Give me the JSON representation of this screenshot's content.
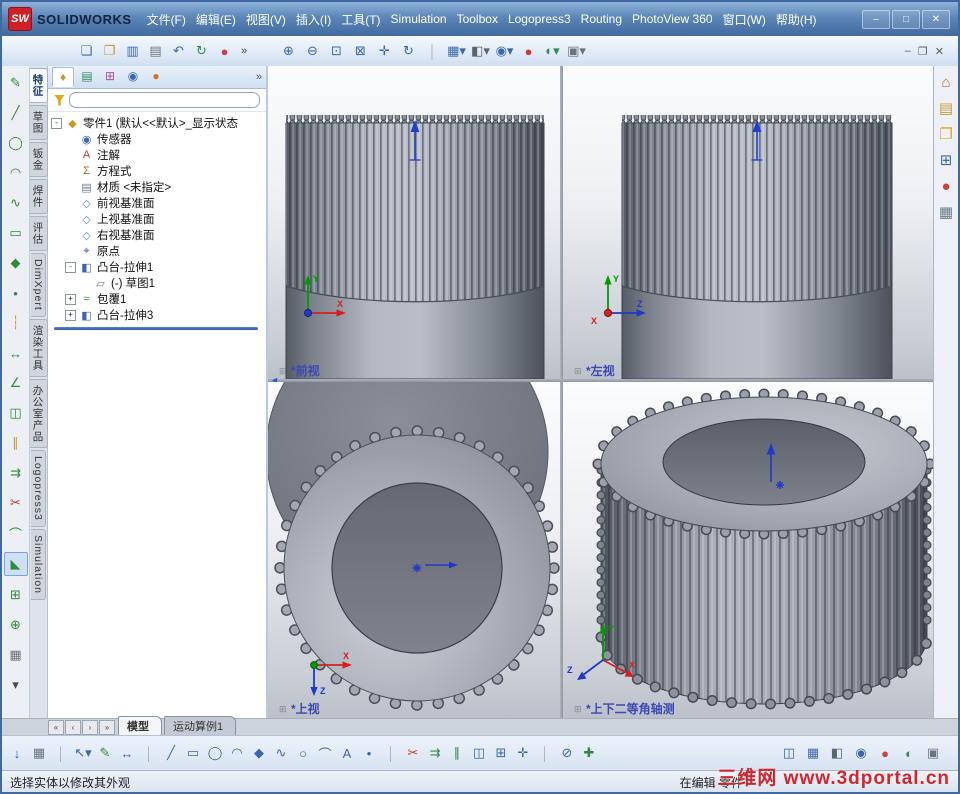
{
  "titlebar": {
    "logo_mark": "SW",
    "logo_text": "SOLIDWORKS",
    "menus": [
      "文件(F)",
      "编辑(E)",
      "视图(V)",
      "插入(I)",
      "工具(T)",
      "Simulation",
      "Toolbox",
      "Logopress3",
      "Routing",
      "PhotoView 360",
      "窗口(W)",
      "帮助(H)"
    ],
    "window_controls": [
      {
        "name": "minimize-button",
        "g": "–"
      },
      {
        "name": "maximize-button",
        "g": "□"
      },
      {
        "name": "close-button",
        "g": "✕"
      }
    ]
  },
  "toolbar": {
    "left_icons": [
      {
        "name": "new-document-icon",
        "g": "❏",
        "c": "#3a68b0"
      },
      {
        "name": "open-document-icon",
        "g": "❐",
        "c": "#c79a2e"
      },
      {
        "name": "save-icon",
        "g": "▥",
        "c": "#3a68b0"
      },
      {
        "name": "print-icon",
        "g": "▤",
        "c": "#6a7480"
      },
      {
        "name": "undo-icon",
        "g": "↶",
        "c": "#3a68b0"
      },
      {
        "name": "rebuild-icon",
        "g": "↻",
        "c": "#2e8b57"
      },
      {
        "name": "edit-appearance-icon",
        "g": "●",
        "c": "#cc4040"
      }
    ],
    "overflow": "»",
    "view_icons": [
      {
        "name": "zoom-in-icon",
        "g": "⊕",
        "c": "#3a68b0"
      },
      {
        "name": "zoom-out-icon",
        "g": "⊖",
        "c": "#3a68b0"
      },
      {
        "name": "zoom-area-icon",
        "g": "⊡",
        "c": "#3a68b0"
      },
      {
        "name": "zoom-fit-icon",
        "g": "⊠",
        "c": "#3a68b0"
      },
      {
        "name": "pan-icon",
        "g": "✛",
        "c": "#3a68b0"
      },
      {
        "name": "rotate-view-icon",
        "g": "↻",
        "c": "#3a68b0"
      },
      {
        "name": "separator-icon",
        "g": "│",
        "c": "#a8b2c0"
      },
      {
        "name": "view-orientation-icon",
        "g": "▦▾",
        "c": "#3a68b0"
      },
      {
        "name": "display-style-icon",
        "g": "◧▾",
        "c": "#5a6470"
      },
      {
        "name": "hide-show-items-icon",
        "g": "◉▾",
        "c": "#3a68b0"
      },
      {
        "name": "appearance-ball-icon",
        "g": "●",
        "c": "#d0392e"
      },
      {
        "name": "scene-icon",
        "g": "◐▾",
        "c": "#2e8b57"
      },
      {
        "name": "camera-icon",
        "g": "▣▾",
        "c": "#6a7480"
      }
    ],
    "doc_controls": [
      {
        "name": "doc-minimize-button",
        "g": "–"
      },
      {
        "name": "doc-restore-button",
        "g": "❐"
      },
      {
        "name": "doc-close-button",
        "g": "✕"
      }
    ]
  },
  "left_toolbar": {
    "icons": [
      {
        "name": "sketch-icon",
        "g": "✎",
        "c": "#2e8b3a"
      },
      {
        "name": "line-icon",
        "g": "╱",
        "c": "#2e8b3a"
      },
      {
        "name": "circle-icon",
        "g": "◯",
        "c": "#2e8b3a"
      },
      {
        "name": "arc-icon",
        "g": "◠",
        "c": "#2e8b3a"
      },
      {
        "name": "spline-icon",
        "g": "∿",
        "c": "#2e8b3a"
      },
      {
        "name": "rectangle-icon",
        "g": "▭",
        "c": "#2e8b3a"
      },
      {
        "name": "polygon-icon",
        "g": "◆",
        "c": "#2e8b3a"
      },
      {
        "name": "point-icon",
        "g": "•",
        "c": "#2e8b3a"
      },
      {
        "name": "centerline-icon",
        "g": "┆",
        "c": "#c79a2e"
      },
      {
        "name": "dimension-icon",
        "g": "↔",
        "c": "#2e8b3a"
      },
      {
        "name": "relation-icon",
        "g": "∠",
        "c": "#2e8b3a"
      },
      {
        "name": "mirror-icon",
        "g": "◫",
        "c": "#2e8b3a"
      },
      {
        "name": "offset-icon",
        "g": "∥",
        "c": "#c79a2e"
      },
      {
        "name": "convert-entities-icon",
        "g": "⇉",
        "c": "#2e8b3a"
      },
      {
        "name": "trim-icon",
        "g": "✂",
        "c": "#c0392b"
      },
      {
        "name": "fillet-icon",
        "g": "⌒",
        "c": "#2e8b3a"
      },
      {
        "name": "chamfer-icon",
        "g": "◣",
        "c": "#2e8b3a",
        "cls": "pressed"
      },
      {
        "name": "linear-pattern-icon",
        "g": "⊞",
        "c": "#2e8b3a"
      },
      {
        "name": "circular-pattern-icon",
        "g": "⊕",
        "c": "#2e8b3a"
      },
      {
        "name": "sketch-picture-icon",
        "g": "▦",
        "c": "#6a7480"
      },
      {
        "name": "more-tools-icon",
        "g": "▾",
        "c": "#444c58"
      }
    ]
  },
  "side_tabs": {
    "items": [
      {
        "label": "特征",
        "cls": "active"
      },
      {
        "label": "草图",
        "cls": ""
      },
      {
        "label": "钣金",
        "cls": ""
      },
      {
        "label": "焊件",
        "cls": ""
      },
      {
        "label": "评估",
        "cls": ""
      },
      {
        "label": "DimXpert",
        "cls": ""
      },
      {
        "label": "渲染工具",
        "cls": ""
      },
      {
        "label": "办公室产品",
        "cls": ""
      },
      {
        "label": "Logopress3",
        "cls": ""
      },
      {
        "label": "Simulation",
        "cls": ""
      }
    ]
  },
  "feature_panel": {
    "manager_tabs": [
      {
        "name": "featuremanager-tree-icon",
        "g": "♦",
        "c": "#c79a2e",
        "cls": "active"
      },
      {
        "name": "propertymanager-icon",
        "g": "▤",
        "c": "#2e8b57"
      },
      {
        "name": "configurationmanager-icon",
        "g": "⊞",
        "c": "#b05090"
      },
      {
        "name": "dimxpertmanager-icon",
        "g": "◉",
        "c": "#3a68b0"
      },
      {
        "name": "displaymanager-icon",
        "g": "●",
        "c": "#d07030"
      }
    ],
    "overflow": "»",
    "tree": [
      {
        "expander": "-",
        "icon": "◆",
        "c": "#c79a2e",
        "label": "零件1 (默认<<默认>_显示状态",
        "cls": "ind0"
      },
      {
        "expander": "",
        "icon": "◉",
        "c": "#3a68b0",
        "label": "传感器",
        "cls": "ind1"
      },
      {
        "expander": "",
        "icon": "A",
        "c": "#b84040",
        "label": "注解",
        "cls": "ind1"
      },
      {
        "expander": "",
        "icon": "Σ",
        "c": "#b06820",
        "label": "方程式",
        "cls": "ind1"
      },
      {
        "expander": "",
        "icon": "▤",
        "c": "#6a7a8a",
        "label": "材质 <未指定>",
        "cls": "ind1"
      },
      {
        "expander": "",
        "icon": "◇",
        "c": "#4a90c0",
        "label": "前视基准面",
        "cls": "ind1"
      },
      {
        "expander": "",
        "icon": "◇",
        "c": "#4a90c0",
        "label": "上视基准面",
        "cls": "ind1"
      },
      {
        "expander": "",
        "icon": "◇",
        "c": "#4a90c0",
        "label": "右视基准面",
        "cls": "ind1"
      },
      {
        "expander": "",
        "icon": "⌖",
        "c": "#2a50b0",
        "label": "原点",
        "cls": "ind1"
      },
      {
        "expander": "-",
        "icon": "◧",
        "c": "#3a68b0",
        "label": "凸台-拉伸1",
        "cls": "ind1"
      },
      {
        "expander": "",
        "icon": "▱",
        "c": "#6a7480",
        "label": "(-) 草图1",
        "cls": "ind2"
      },
      {
        "expander": "+",
        "icon": "≈",
        "c": "#2e8b32",
        "label": "包覆1",
        "cls": "ind1"
      },
      {
        "expander": "+",
        "icon": "◧",
        "c": "#3a68b0",
        "label": "凸台-拉伸3",
        "cls": "ind1"
      }
    ]
  },
  "viewports": {
    "front": {
      "label": "*前视"
    },
    "left": {
      "label": "*左视"
    },
    "top": {
      "label": "*上视"
    },
    "iso": {
      "label": "*上下二等角轴测"
    },
    "axis_labels": {
      "x": "X",
      "y": "Y",
      "z": "Z"
    },
    "accent_blue": "#2038c8",
    "part_gray": "#a6abb5"
  },
  "task_pane": {
    "icons": [
      {
        "name": "home-icon",
        "g": "⌂",
        "c": "#b07830"
      },
      {
        "name": "design-library-icon",
        "g": "▤",
        "c": "#c79a2e"
      },
      {
        "name": "file-explorer-icon",
        "g": "❐",
        "c": "#d8a818"
      },
      {
        "name": "view-palette-icon",
        "g": "⊞",
        "c": "#3a68b0"
      },
      {
        "name": "appearances-icon",
        "g": "●",
        "c": "#cc4040"
      },
      {
        "name": "custom-properties-icon",
        "g": "▦",
        "c": "#6a7a8a"
      }
    ]
  },
  "bottom_tabs": {
    "nav": [
      {
        "name": "first-tab-button",
        "g": "«"
      },
      {
        "name": "prev-tab-button",
        "g": "‹"
      },
      {
        "name": "next-tab-button",
        "g": "›"
      },
      {
        "name": "last-tab-button",
        "g": "»"
      }
    ],
    "tabs": [
      {
        "label": "模型",
        "cls": "active"
      },
      {
        "label": "运动算例1",
        "cls": ""
      }
    ]
  },
  "bottom_toolbar": {
    "left_icons": [
      {
        "name": "snap-icon",
        "g": "↓",
        "c": "#2458c8"
      },
      {
        "name": "grid-icon",
        "g": "▦",
        "c": "#6a7480"
      },
      {
        "name": "separator-icon",
        "g": "│",
        "c": "#a8b2c0"
      },
      {
        "name": "select-icon",
        "g": "↖▾",
        "c": "#3a68b0"
      },
      {
        "name": "sketch-icon",
        "g": "✎",
        "c": "#2e8b3a"
      },
      {
        "name": "smart-dimension-icon",
        "g": "↔",
        "c": "#3a68b0"
      },
      {
        "name": "separator-icon",
        "g": "│",
        "c": "#a8b2c0"
      },
      {
        "name": "line-icon",
        "g": "╱",
        "c": "#3a68b0"
      },
      {
        "name": "rectangle-icon",
        "g": "▭",
        "c": "#3a68b0"
      },
      {
        "name": "circle-icon",
        "g": "◯",
        "c": "#3a68b0"
      },
      {
        "name": "arc-icon",
        "g": "◠",
        "c": "#3a68b0"
      },
      {
        "name": "polygon-icon",
        "g": "◆",
        "c": "#3a68b0"
      },
      {
        "name": "spline-icon",
        "g": "∿",
        "c": "#3a68b0"
      },
      {
        "name": "ellipse-icon",
        "g": "○",
        "c": "#3a68b0"
      },
      {
        "name": "fillet-icon",
        "g": "⌒",
        "c": "#3a68b0"
      },
      {
        "name": "text-icon",
        "g": "A",
        "c": "#3a68b0"
      },
      {
        "name": "point-icon",
        "g": "•",
        "c": "#3a68b0"
      },
      {
        "name": "separator-icon",
        "g": "│",
        "c": "#a8b2c0"
      },
      {
        "name": "trim-icon",
        "g": "✂",
        "c": "#c0392b"
      },
      {
        "name": "convert-entities-icon",
        "g": "⇉",
        "c": "#2e8b3a"
      },
      {
        "name": "offset-icon",
        "g": "∥",
        "c": "#2e8b3a"
      },
      {
        "name": "mirror-icon",
        "g": "◫",
        "c": "#3a68b0"
      },
      {
        "name": "linear-pattern-icon",
        "g": "⊞",
        "c": "#3a68b0"
      },
      {
        "name": "move-icon",
        "g": "✛",
        "c": "#3a68b0"
      },
      {
        "name": "separator-icon",
        "g": "│",
        "c": "#a8b2c0"
      },
      {
        "name": "display-delete-relations-icon",
        "g": "⊘",
        "c": "#3a68b0"
      },
      {
        "name": "repair-sketch-icon",
        "g": "✚",
        "c": "#2e8b3a"
      }
    ],
    "right_icons": [
      {
        "name": "section-view-icon",
        "g": "◫",
        "c": "#3a68b0"
      },
      {
        "name": "view-orientation-icon",
        "g": "▦",
        "c": "#3a68b0"
      },
      {
        "name": "display-style-icon",
        "g": "◧",
        "c": "#5a6470"
      },
      {
        "name": "hide-items-icon",
        "g": "◉",
        "c": "#3a68b0"
      },
      {
        "name": "edit-appearance-icon",
        "g": "●",
        "c": "#cc4040"
      },
      {
        "name": "scene-icon",
        "g": "◐",
        "c": "#2e8b57"
      },
      {
        "name": "camera-icon",
        "g": "▣",
        "c": "#6a7480"
      }
    ]
  },
  "statusbar": {
    "left": "选择实体以修改其外观",
    "editing": "在编辑 零件",
    "watermark": "三维网 www.3dportal.cn"
  }
}
